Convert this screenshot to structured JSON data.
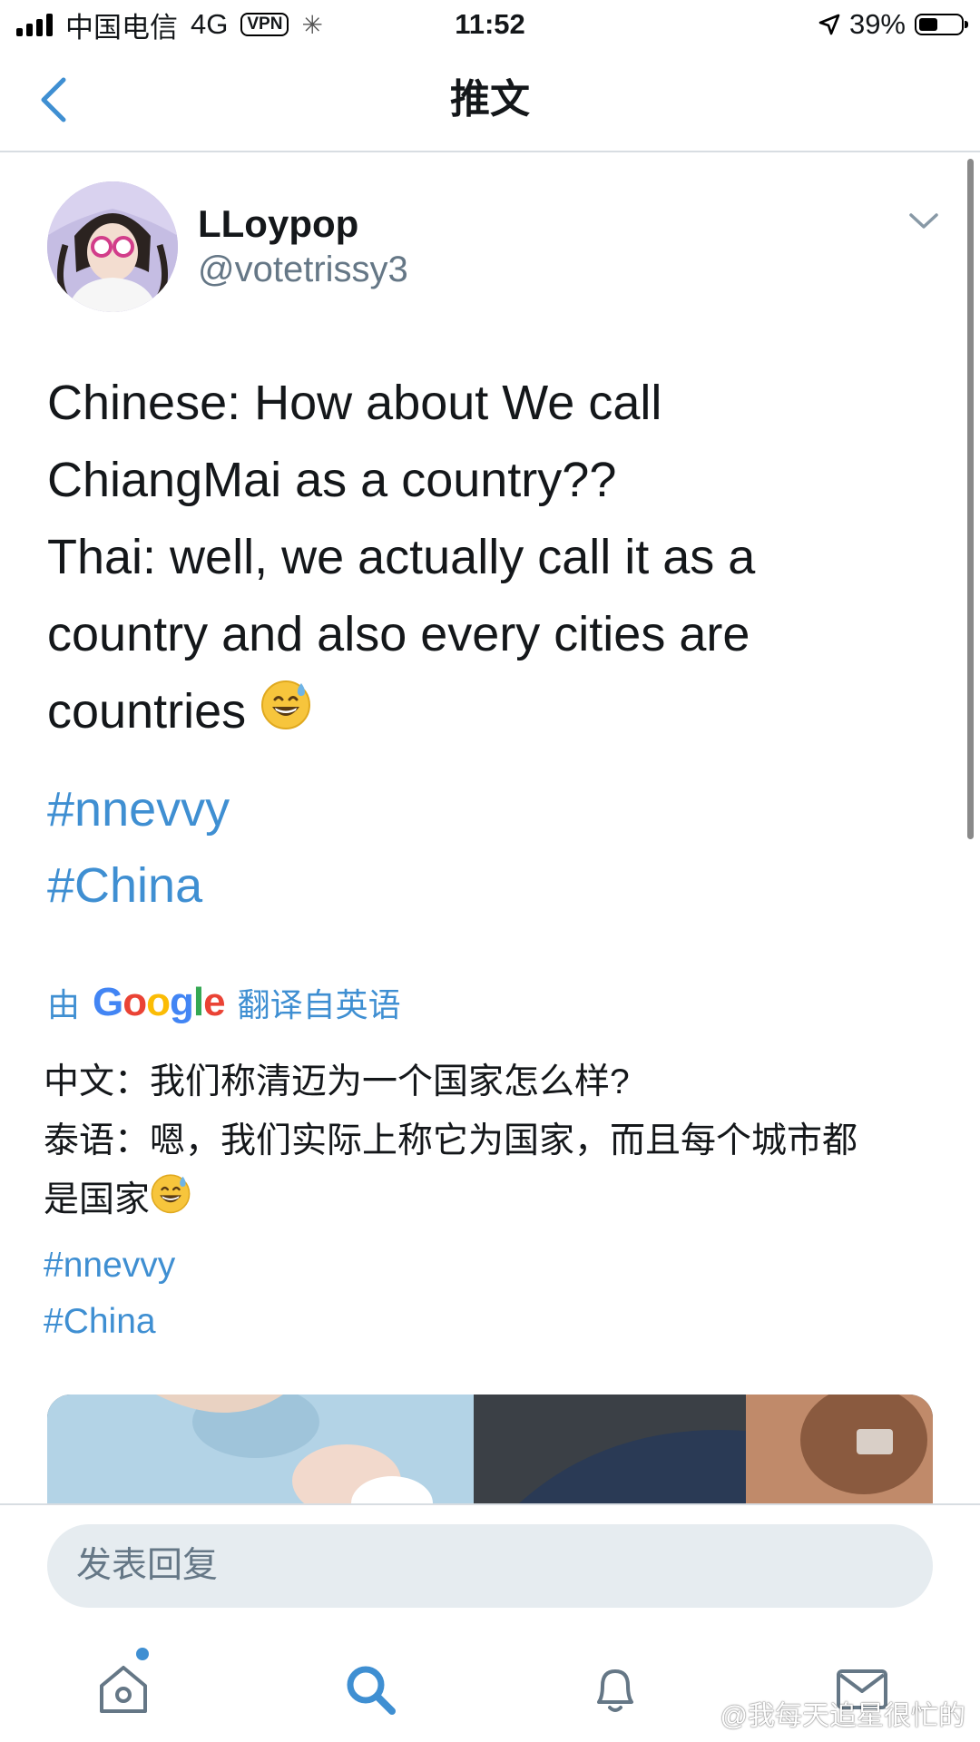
{
  "status_bar": {
    "carrier": "中国电信",
    "network": "4G",
    "vpn": "VPN",
    "time": "11:52",
    "battery": "39%",
    "battery_level": 0.39
  },
  "nav": {
    "back_icon": "chevron-left-icon",
    "title": "推文"
  },
  "tweet": {
    "display_name": "LLoypop",
    "handle": "@votetrissy3",
    "lines": [
      "Chinese: How about We call",
      "ChiangMai as a country??",
      "Thai: well, we actually call it as a",
      "country and also every cities are",
      "countries"
    ],
    "emoji": "grinning-face-with-sweat",
    "hashtags": [
      "#nnevvy",
      "#China"
    ]
  },
  "translation": {
    "prefix": "由",
    "provider": "Google",
    "suffix": "翻译自英语",
    "lines": [
      "中文：我们称清迈为一个国家怎么样?",
      "泰语：嗯，我们实际上称它为国家，而且每个城市都",
      "是国家"
    ],
    "hashtags": [
      "#nnevvy",
      "#China"
    ]
  },
  "reply": {
    "placeholder": "发表回复"
  },
  "tab_bar": {
    "items": [
      "home-icon",
      "search-icon",
      "bell-icon",
      "mail-icon"
    ]
  },
  "watermark": "@我每天追星很忙的",
  "colors": {
    "accent": "#3f8fd2",
    "secondary_text": "#657786",
    "reply_bg": "#e6ecf0"
  }
}
